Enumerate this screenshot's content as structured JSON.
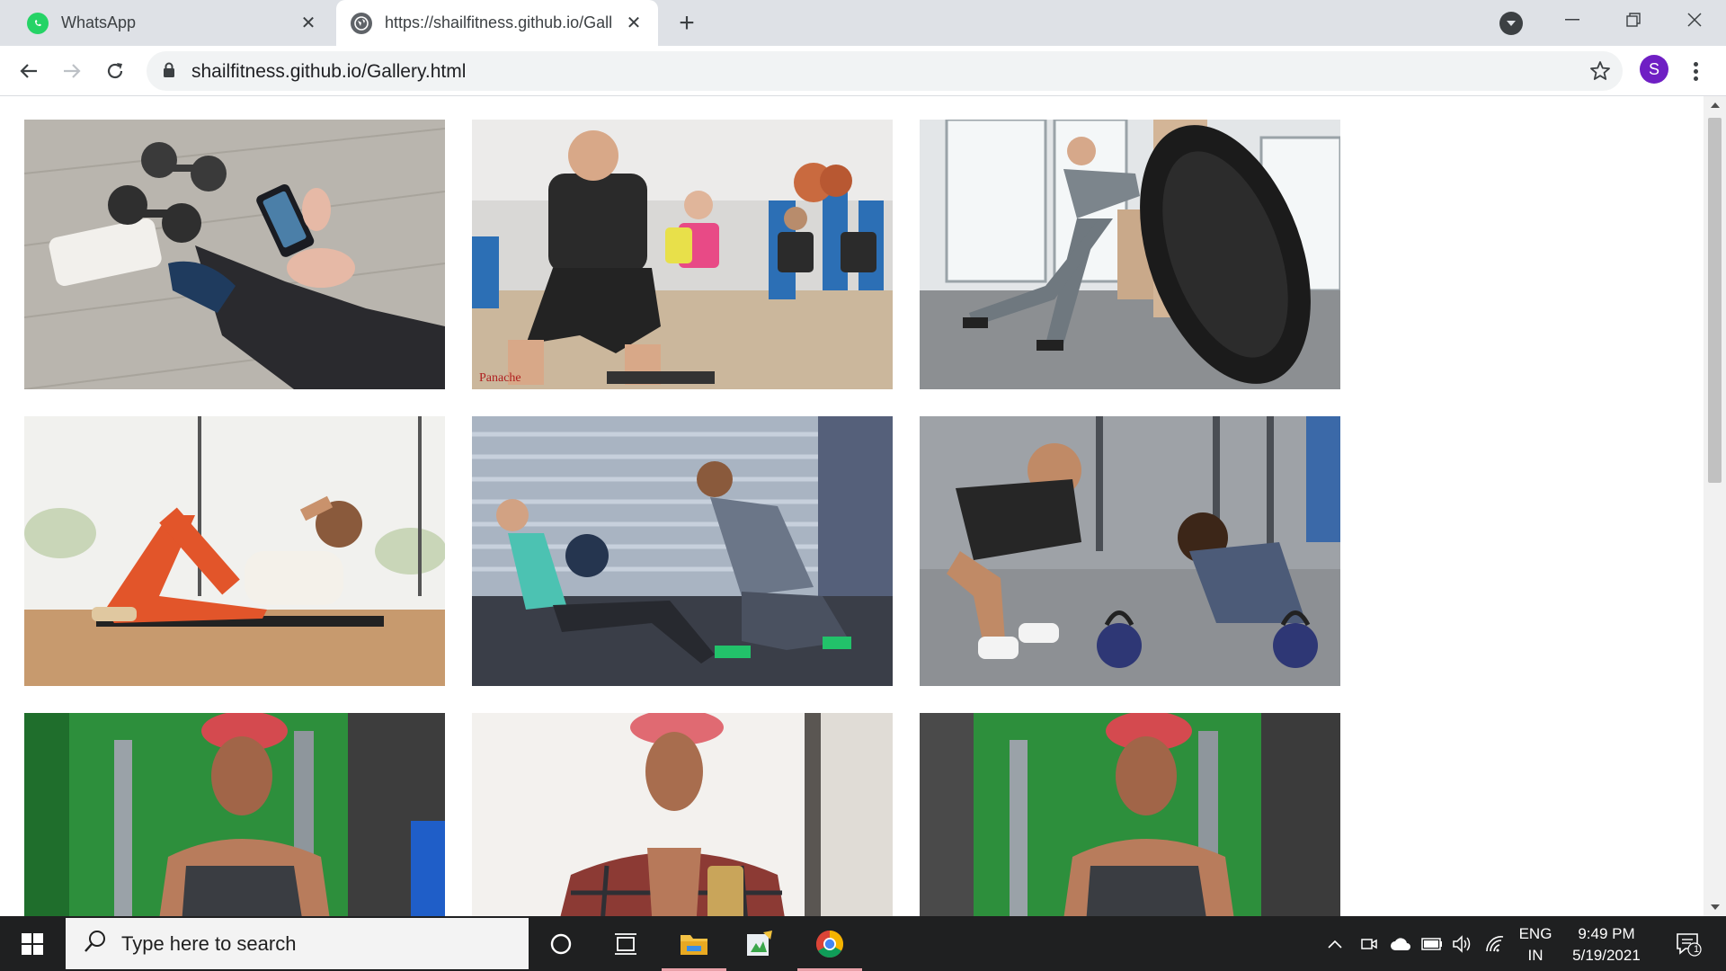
{
  "browser": {
    "tabs": [
      {
        "title": "WhatsApp",
        "icon": "whatsapp-icon",
        "active": false
      },
      {
        "title": "https://shailfitness.github.io/Gall",
        "icon": "globe-icon",
        "active": true
      }
    ],
    "address_bar": {
      "url": "shailfitness.github.io/Gallery.html"
    },
    "profile_initial": "S"
  },
  "gallery": {
    "images": [
      {
        "name": "dumbbells-phone-workout",
        "caption": ""
      },
      {
        "name": "group-squat-class",
        "caption": "Panache"
      },
      {
        "name": "tire-flip-workout",
        "caption": ""
      },
      {
        "name": "crunches-on-mat",
        "caption": ""
      },
      {
        "name": "partner-medicine-ball-situps",
        "caption": ""
      },
      {
        "name": "kettlebell-pushups-with-trainer",
        "caption": ""
      },
      {
        "name": "gym-selfie-1",
        "caption": ""
      },
      {
        "name": "mirror-selfie",
        "caption": ""
      },
      {
        "name": "gym-selfie-2",
        "caption": ""
      }
    ]
  },
  "taskbar": {
    "search_placeholder": "Type here to search",
    "language_line1": "ENG",
    "language_line2": "IN",
    "time": "9:49 PM",
    "date": "5/19/2021",
    "notification_count": "1"
  },
  "colors": {
    "tab_strip": "#dee1e6",
    "taskbar": "#1f2021",
    "avatar": "#6f1fc4",
    "whatsapp": "#25d366"
  }
}
